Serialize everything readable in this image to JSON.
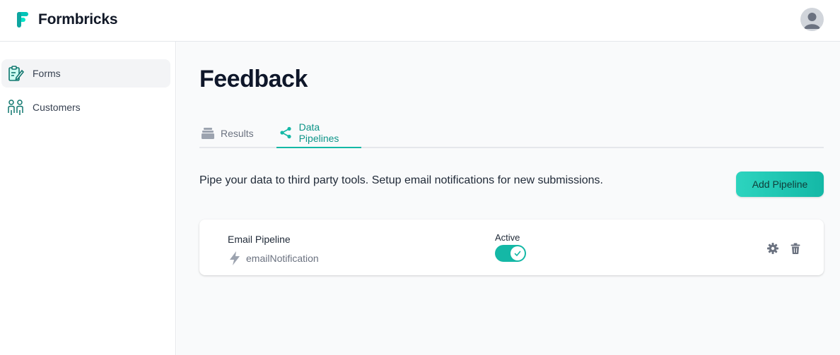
{
  "app": {
    "name": "Formbricks",
    "brand_color": "#14b8a6"
  },
  "header": {
    "avatar_icon": "user-avatar-icon"
  },
  "sidebar": {
    "items": [
      {
        "label": "Forms",
        "icon": "clipboard-edit-icon",
        "active": true
      },
      {
        "label": "Customers",
        "icon": "users-icon",
        "active": false
      }
    ]
  },
  "main": {
    "title": "Feedback",
    "tabs": [
      {
        "label": "Results",
        "icon": "inbox-stack-icon",
        "active": false
      },
      {
        "label": "Data Pipelines",
        "icon": "share-icon",
        "active": true
      }
    ],
    "description": "Pipe your data to third party tools. Setup email notifications for new submissions.",
    "add_button_label": "Add Pipeline",
    "pipelines": [
      {
        "name": "Email Pipeline",
        "type": "emailNotification",
        "status_label": "Active",
        "enabled": true
      }
    ]
  }
}
